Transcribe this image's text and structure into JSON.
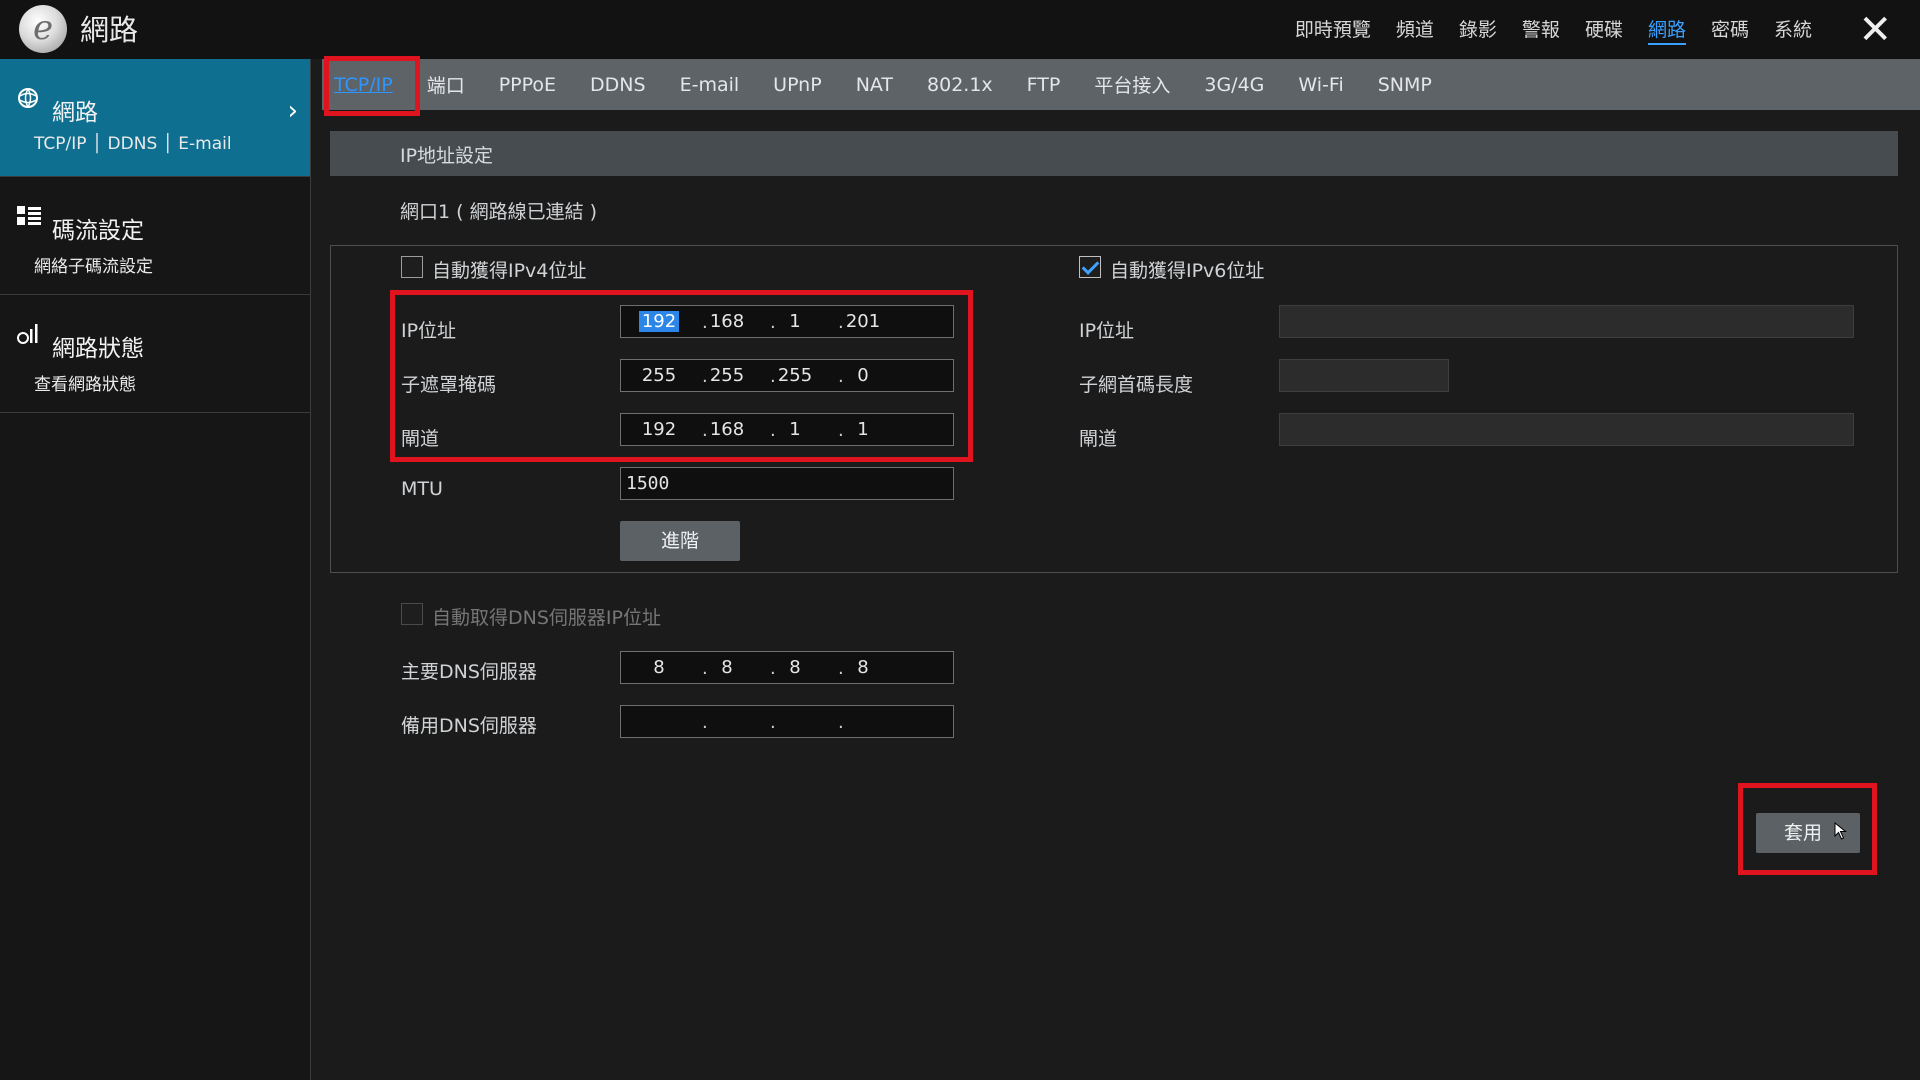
{
  "app": {
    "title": "網路"
  },
  "top_nav": {
    "items": [
      "即時預覽",
      "頻道",
      "錄影",
      "警報",
      "硬碟",
      "網路",
      "密碼",
      "系統"
    ],
    "active": "網路"
  },
  "close_label": "✕",
  "sidebar": {
    "items": [
      {
        "title": "網路",
        "subtitle": "TCP/IP │ DDNS │ E-mail",
        "icon": "network-globe-icon",
        "active": true,
        "chevron": "›"
      },
      {
        "title": "碼流設定",
        "subtitle": "網絡子碼流設定",
        "icon": "grid-list-icon",
        "active": false
      },
      {
        "title": "網路狀態",
        "subtitle": "查看網路狀態",
        "icon": "signal-bars-icon",
        "active": false
      }
    ]
  },
  "tabs": {
    "items": [
      "TCP/IP",
      "端口",
      "PPPoE",
      "DDNS",
      "E-mail",
      "UPnP",
      "NAT",
      "802.1x",
      "FTP",
      "平台接入",
      "3G/4G",
      "Wi-Fi",
      "SNMP"
    ],
    "active": "TCP/IP"
  },
  "section": {
    "title": "IP地址設定",
    "port_status": "網口1 ( 網路線已連結 )"
  },
  "ipv4": {
    "auto_label": "自動獲得IPv4位址",
    "auto_checked": false,
    "ip_label": "IP位址",
    "ip": [
      "192",
      "168",
      "1",
      "201"
    ],
    "mask_label": "子遮罩掩碼",
    "mask": [
      "255",
      "255",
      "255",
      "0"
    ],
    "gateway_label": "閘道",
    "gateway": [
      "192",
      "168",
      "1",
      "1"
    ],
    "mtu_label": "MTU",
    "mtu": "1500",
    "advanced_button": "進階"
  },
  "ipv6": {
    "auto_label": "自動獲得IPv6位址",
    "auto_checked": true,
    "ip_label": "IP位址",
    "prefix_label": "子網首碼長度",
    "gateway_label": "閘道"
  },
  "dns": {
    "auto_label": "自動取得DNS伺服器IP位址",
    "auto_checked": false,
    "primary_label": "主要DNS伺服器",
    "primary": [
      "8",
      "8",
      "8",
      "8"
    ],
    "secondary_label": "備用DNS伺服器",
    "secondary": [
      "",
      "",
      "",
      ""
    ]
  },
  "apply_button": "套用",
  "colors": {
    "accent": "#2f95ff",
    "sidebar_active": "#0e6f90",
    "highlight_box": "#e0141e",
    "tab_bar": "#5e6368"
  }
}
